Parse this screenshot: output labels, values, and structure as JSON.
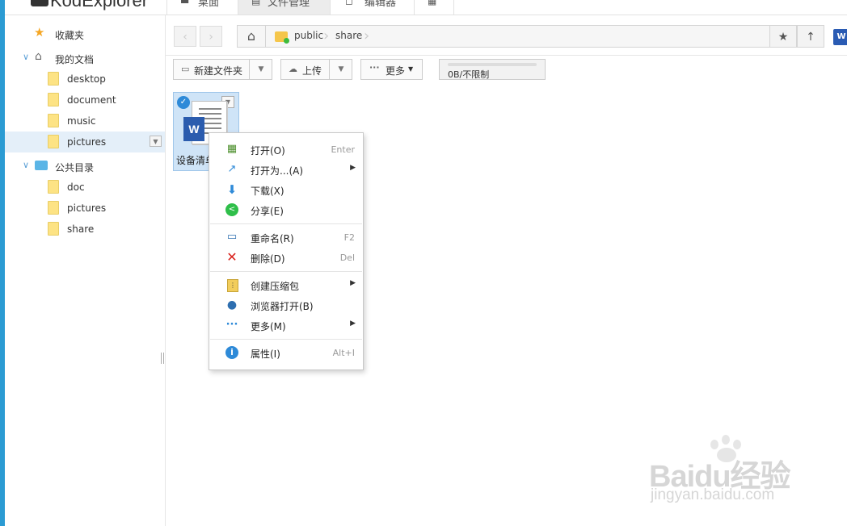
{
  "app": {
    "brand": "KodExplorer"
  },
  "top_tabs": [
    {
      "icon": "▬",
      "label": "桌面"
    },
    {
      "icon": "▤",
      "label": "文件管理"
    },
    {
      "icon": "◻",
      "label": "编辑器"
    },
    {
      "icon": "▦",
      "label": ""
    }
  ],
  "sidebar": {
    "favorites": "收藏夹",
    "my_docs": "我的文档",
    "my_docs_items": [
      "desktop",
      "document",
      "music",
      "pictures"
    ],
    "public_dir": "公共目录",
    "public_items": [
      "doc",
      "pictures",
      "share"
    ]
  },
  "address": {
    "back": "‹",
    "forward": "›",
    "crumbs": [
      "public",
      "share"
    ],
    "star": "★",
    "up": "↑",
    "word_badge": "W"
  },
  "toolbar": {
    "new_folder": "新建文件夹",
    "upload": "上传",
    "more": "更多",
    "quota": "0B/不限制"
  },
  "file": {
    "name": "设备清单",
    "doc_letter": "W"
  },
  "context_menu": [
    {
      "icon": "open",
      "label": "打开(O)",
      "key": "Enter",
      "submenu": false
    },
    {
      "icon": "open-as",
      "label": "打开为...(A)",
      "key": "",
      "submenu": true
    },
    {
      "icon": "download",
      "label": "下载(X)",
      "key": "",
      "submenu": false
    },
    {
      "icon": "share",
      "label": "分享(E)",
      "key": "",
      "submenu": false
    },
    {
      "icon": "rename",
      "label": "重命名(R)",
      "key": "F2",
      "submenu": false
    },
    {
      "icon": "delete",
      "label": "删除(D)",
      "key": "Del",
      "submenu": false
    },
    {
      "icon": "zip",
      "label": "创建压缩包",
      "key": "",
      "submenu": true
    },
    {
      "icon": "globe",
      "label": "浏览器打开(B)",
      "key": "",
      "submenu": false
    },
    {
      "icon": "more",
      "label": "更多(M)",
      "key": "",
      "submenu": true
    },
    {
      "icon": "info",
      "label": "属性(I)",
      "key": "Alt+I",
      "submenu": false
    }
  ],
  "watermark": {
    "main": "Baidu经验",
    "url": "jingyan.baidu.com"
  },
  "colors": {
    "accent": "#2b9bd3",
    "selected_bg": "#e4eff9",
    "item_bg": "#cfe4f7"
  }
}
